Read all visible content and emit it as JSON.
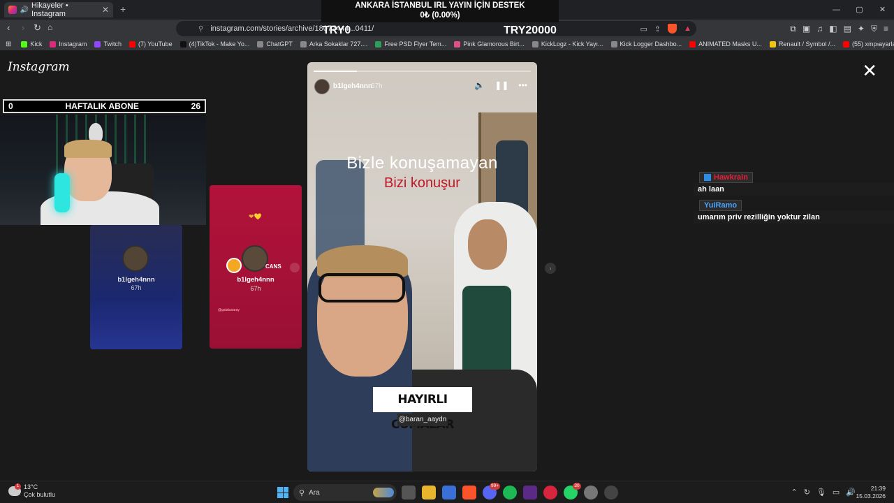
{
  "browser": {
    "tab_title": "Hikayeler • Instagram",
    "new_tab": "+",
    "url": "instagram.com/stories/archive/18077444...0411/",
    "window_controls": [
      "—",
      "▢",
      "✕"
    ],
    "bookmarks": [
      {
        "label": "Kick",
        "color": "#53fc18"
      },
      {
        "label": "Instagram",
        "color": "#dd2a7b"
      },
      {
        "label": "Twitch",
        "color": "#9146ff"
      },
      {
        "label": "(7) YouTube",
        "color": "#ff0000"
      },
      {
        "label": "(4)TikTok - Make Yo...",
        "color": "#111111"
      },
      {
        "label": "ChatGPT",
        "color": "#888888"
      },
      {
        "label": "Arka Sokaklar 727....",
        "color": "#888888"
      },
      {
        "label": "Free PSD Flyer Tem...",
        "color": "#2e9e5b"
      },
      {
        "label": "Pink Glamorous Birt...",
        "color": "#e05080"
      },
      {
        "label": "KickLogz - Kick Yayı...",
        "color": "#888888"
      },
      {
        "label": "Kick Logger Dashbo...",
        "color": "#888888"
      },
      {
        "label": "ANIMATED Masks U...",
        "color": "#ff0000"
      },
      {
        "label": "Renault / Symbol /...",
        "color": "#f1c40f"
      },
      {
        "label": "(55) xmp ayarları - Y...",
        "color": "#ff0000"
      }
    ],
    "bookmarks_more": "»"
  },
  "stream_overlay": {
    "title_line1": "ANKARA İSTANBUL IRL YAYIN İÇİN DESTEK",
    "title_line2": "0₺ (0.00%)",
    "try_left": "TRY0",
    "try_right": "TRY20000",
    "subs_left": "0",
    "subs_label": "HAFTALIK ABONE",
    "subs_right": "26"
  },
  "instagram": {
    "logo": "Instagram",
    "close": "✕",
    "side_cards": [
      {
        "username": "b1lgeh4nnn",
        "ago": "67h"
      },
      {
        "username": "b1lgeh4nnn",
        "ago": "67h",
        "extra": "CANS",
        "hearts": "❤💛",
        "small": "@galatasaray"
      }
    ],
    "story": {
      "progress": 0.2,
      "username": "b1lgeh4nnn",
      "ago": "67h",
      "text_line1": "Bizle konuşamayan",
      "text_line2": "Bizi konuşur",
      "banner": "HAYIRLI CUMALAR",
      "mention": "@baran_aaydn"
    }
  },
  "chat": [
    {
      "user": "Hawkrain",
      "user_color": "#e8203a",
      "message": "ah laan"
    },
    {
      "user": "YuiRamo",
      "user_color": "#4aa3ff",
      "message": "umarım priv rezilliğin yoktur zilan"
    }
  ],
  "taskbar": {
    "weather_temp": "13°C",
    "weather_desc": "Çok bulutlu",
    "weather_badge": "1",
    "search": "Ara",
    "badge_discord": "99+",
    "badge_whatsapp": "30",
    "time": "21:39",
    "date": "15.03.2026"
  }
}
